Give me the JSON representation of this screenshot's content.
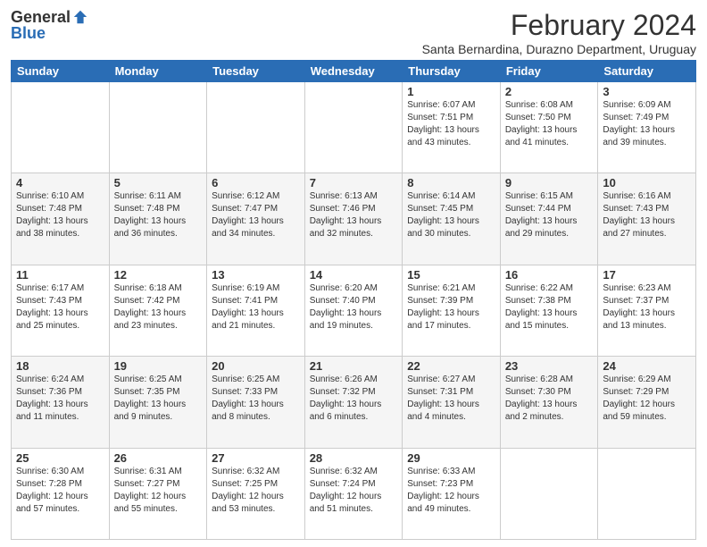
{
  "header": {
    "logo_general": "General",
    "logo_blue": "Blue",
    "month_year": "February 2024",
    "location": "Santa Bernardina, Durazno Department, Uruguay"
  },
  "days_of_week": [
    "Sunday",
    "Monday",
    "Tuesday",
    "Wednesday",
    "Thursday",
    "Friday",
    "Saturday"
  ],
  "weeks": [
    {
      "shaded": false,
      "days": [
        {
          "num": "",
          "info": ""
        },
        {
          "num": "",
          "info": ""
        },
        {
          "num": "",
          "info": ""
        },
        {
          "num": "",
          "info": ""
        },
        {
          "num": "1",
          "info": "Sunrise: 6:07 AM\nSunset: 7:51 PM\nDaylight: 13 hours\nand 43 minutes."
        },
        {
          "num": "2",
          "info": "Sunrise: 6:08 AM\nSunset: 7:50 PM\nDaylight: 13 hours\nand 41 minutes."
        },
        {
          "num": "3",
          "info": "Sunrise: 6:09 AM\nSunset: 7:49 PM\nDaylight: 13 hours\nand 39 minutes."
        }
      ]
    },
    {
      "shaded": true,
      "days": [
        {
          "num": "4",
          "info": "Sunrise: 6:10 AM\nSunset: 7:48 PM\nDaylight: 13 hours\nand 38 minutes."
        },
        {
          "num": "5",
          "info": "Sunrise: 6:11 AM\nSunset: 7:48 PM\nDaylight: 13 hours\nand 36 minutes."
        },
        {
          "num": "6",
          "info": "Sunrise: 6:12 AM\nSunset: 7:47 PM\nDaylight: 13 hours\nand 34 minutes."
        },
        {
          "num": "7",
          "info": "Sunrise: 6:13 AM\nSunset: 7:46 PM\nDaylight: 13 hours\nand 32 minutes."
        },
        {
          "num": "8",
          "info": "Sunrise: 6:14 AM\nSunset: 7:45 PM\nDaylight: 13 hours\nand 30 minutes."
        },
        {
          "num": "9",
          "info": "Sunrise: 6:15 AM\nSunset: 7:44 PM\nDaylight: 13 hours\nand 29 minutes."
        },
        {
          "num": "10",
          "info": "Sunrise: 6:16 AM\nSunset: 7:43 PM\nDaylight: 13 hours\nand 27 minutes."
        }
      ]
    },
    {
      "shaded": false,
      "days": [
        {
          "num": "11",
          "info": "Sunrise: 6:17 AM\nSunset: 7:43 PM\nDaylight: 13 hours\nand 25 minutes."
        },
        {
          "num": "12",
          "info": "Sunrise: 6:18 AM\nSunset: 7:42 PM\nDaylight: 13 hours\nand 23 minutes."
        },
        {
          "num": "13",
          "info": "Sunrise: 6:19 AM\nSunset: 7:41 PM\nDaylight: 13 hours\nand 21 minutes."
        },
        {
          "num": "14",
          "info": "Sunrise: 6:20 AM\nSunset: 7:40 PM\nDaylight: 13 hours\nand 19 minutes."
        },
        {
          "num": "15",
          "info": "Sunrise: 6:21 AM\nSunset: 7:39 PM\nDaylight: 13 hours\nand 17 minutes."
        },
        {
          "num": "16",
          "info": "Sunrise: 6:22 AM\nSunset: 7:38 PM\nDaylight: 13 hours\nand 15 minutes."
        },
        {
          "num": "17",
          "info": "Sunrise: 6:23 AM\nSunset: 7:37 PM\nDaylight: 13 hours\nand 13 minutes."
        }
      ]
    },
    {
      "shaded": true,
      "days": [
        {
          "num": "18",
          "info": "Sunrise: 6:24 AM\nSunset: 7:36 PM\nDaylight: 13 hours\nand 11 minutes."
        },
        {
          "num": "19",
          "info": "Sunrise: 6:25 AM\nSunset: 7:35 PM\nDaylight: 13 hours\nand 9 minutes."
        },
        {
          "num": "20",
          "info": "Sunrise: 6:25 AM\nSunset: 7:33 PM\nDaylight: 13 hours\nand 8 minutes."
        },
        {
          "num": "21",
          "info": "Sunrise: 6:26 AM\nSunset: 7:32 PM\nDaylight: 13 hours\nand 6 minutes."
        },
        {
          "num": "22",
          "info": "Sunrise: 6:27 AM\nSunset: 7:31 PM\nDaylight: 13 hours\nand 4 minutes."
        },
        {
          "num": "23",
          "info": "Sunrise: 6:28 AM\nSunset: 7:30 PM\nDaylight: 13 hours\nand 2 minutes."
        },
        {
          "num": "24",
          "info": "Sunrise: 6:29 AM\nSunset: 7:29 PM\nDaylight: 12 hours\nand 59 minutes."
        }
      ]
    },
    {
      "shaded": false,
      "days": [
        {
          "num": "25",
          "info": "Sunrise: 6:30 AM\nSunset: 7:28 PM\nDaylight: 12 hours\nand 57 minutes."
        },
        {
          "num": "26",
          "info": "Sunrise: 6:31 AM\nSunset: 7:27 PM\nDaylight: 12 hours\nand 55 minutes."
        },
        {
          "num": "27",
          "info": "Sunrise: 6:32 AM\nSunset: 7:25 PM\nDaylight: 12 hours\nand 53 minutes."
        },
        {
          "num": "28",
          "info": "Sunrise: 6:32 AM\nSunset: 7:24 PM\nDaylight: 12 hours\nand 51 minutes."
        },
        {
          "num": "29",
          "info": "Sunrise: 6:33 AM\nSunset: 7:23 PM\nDaylight: 12 hours\nand 49 minutes."
        },
        {
          "num": "",
          "info": ""
        },
        {
          "num": "",
          "info": ""
        }
      ]
    }
  ]
}
